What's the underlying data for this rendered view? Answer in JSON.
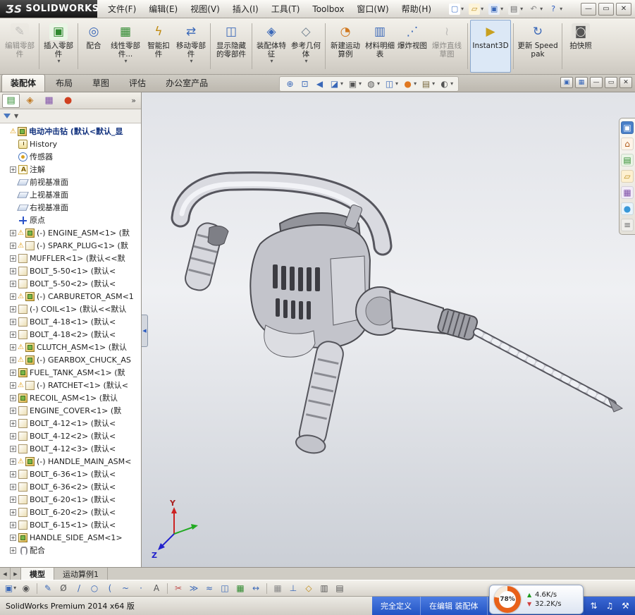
{
  "titlebar": {
    "logo_mark": "ƷS",
    "logo_text": "SOLIDWORKS",
    "menus": [
      "文件(F)",
      "编辑(E)",
      "视图(V)",
      "插入(I)",
      "工具(T)",
      "Toolbox",
      "窗口(W)",
      "帮助(H)"
    ],
    "qat": [
      {
        "name": "new-document",
        "ch": "▢",
        "fg": "#4a78c8",
        "bg": "#ffffff",
        "dd": true
      },
      {
        "name": "open-document",
        "ch": "▱",
        "fg": "#c09020",
        "bg": "#fdf4da",
        "dd": true
      },
      {
        "name": "save-document",
        "ch": "▣",
        "fg": "#3a68b8",
        "bg": "#e8eef8",
        "dd": true
      },
      {
        "name": "print-document",
        "ch": "▤",
        "fg": "#666666",
        "bg": "#eeede9",
        "dd": true
      },
      {
        "name": "undo",
        "ch": "↶",
        "fg": "#888888",
        "dd": true
      },
      {
        "name": "help",
        "ch": "?",
        "fg": "#2a5ac0",
        "dd": true
      }
    ],
    "window_controls": [
      {
        "name": "window-minimize",
        "ch": "—"
      },
      {
        "name": "window-maximize",
        "ch": "▭"
      },
      {
        "name": "window-close",
        "ch": "✕"
      }
    ]
  },
  "ribbon": {
    "buttons": [
      {
        "name": "edit-component",
        "label": "编辑零部件",
        "disabled": true,
        "icon": {
          "ch": "✎",
          "fg": "#8a8a8a",
          "bg": "#e9e6df"
        },
        "sep": true,
        "w": 48
      },
      {
        "name": "insert-component",
        "label": "插入零部件",
        "dd": true,
        "icon": {
          "ch": "▣",
          "fg": "#2f8a2f",
          "bg": "#eaf5e6"
        },
        "sep": true,
        "w": 48
      },
      {
        "name": "mate",
        "label": "配合",
        "icon": {
          "ch": "◎",
          "fg": "#3a68b8"
        },
        "w": 38
      },
      {
        "name": "linear-component-pattern",
        "label": "线性零部件...",
        "dd": true,
        "icon": {
          "ch": "▦",
          "fg": "#2f8a2f"
        },
        "w": 50
      },
      {
        "name": "smart-fasteners",
        "label": "智能扣件",
        "icon": {
          "ch": "ϟ",
          "fg": "#c08a10"
        },
        "w": 42
      },
      {
        "name": "move-component",
        "label": "移动零部件",
        "dd": true,
        "icon": {
          "ch": "⇄",
          "fg": "#3a68b8"
        },
        "sep": true,
        "w": 48
      },
      {
        "name": "show-hidden-components",
        "label": "显示隐藏的零部件",
        "icon": {
          "ch": "◫",
          "fg": "#3a68b8"
        },
        "sep": true,
        "w": 52
      },
      {
        "name": "assembly-features",
        "label": "装配体特征",
        "dd": true,
        "icon": {
          "ch": "◈",
          "fg": "#3a68b8"
        },
        "w": 48
      },
      {
        "name": "reference-geometry",
        "label": "参考几何体",
        "dd": true,
        "icon": {
          "ch": "◇",
          "fg": "#708090"
        },
        "sep": true,
        "w": 48
      },
      {
        "name": "new-motion-study",
        "label": "新建运动算例",
        "icon": {
          "ch": "◔",
          "fg": "#d07820"
        },
        "w": 50
      },
      {
        "name": "bill-of-materials",
        "label": "材料明细表",
        "icon": {
          "ch": "▥",
          "fg": "#3a68b8"
        },
        "w": 46
      },
      {
        "name": "exploded-view",
        "label": "爆炸视图",
        "icon": {
          "ch": "⋰",
          "fg": "#3a68b8"
        },
        "w": 44
      },
      {
        "name": "explode-line-sketch",
        "label": "爆炸直线草图",
        "disabled": true,
        "icon": {
          "ch": "≀",
          "fg": "#8a8a8a"
        },
        "sep": true,
        "w": 52
      },
      {
        "name": "instant3d",
        "label": "Instant3D",
        "pressed": true,
        "icon": {
          "ch": "▶",
          "fg": "#c8a020"
        },
        "sep": true,
        "w": 58
      },
      {
        "name": "update-speedpak",
        "label": "更新 Speedpak",
        "icon": {
          "ch": "↻",
          "fg": "#3a68b8"
        },
        "sep": true,
        "w": 62
      },
      {
        "name": "take-snapshot",
        "label": "拍快照",
        "icon": {
          "ch": "◙",
          "fg": "#555555",
          "bg": "#e4e2dc"
        },
        "w": 46
      }
    ]
  },
  "tabs": [
    {
      "label": "装配体",
      "active": true
    },
    {
      "label": "布局"
    },
    {
      "label": "草图"
    },
    {
      "label": "评估"
    },
    {
      "label": "办公室产品"
    }
  ],
  "headsup": [
    {
      "name": "zoom-to-fit",
      "ch": "⊕",
      "fg": "#3a68b8"
    },
    {
      "name": "zoom-to-area",
      "ch": "⊡",
      "fg": "#3a68b8"
    },
    {
      "name": "previous-view",
      "ch": "◀",
      "fg": "#3a68b8"
    },
    {
      "name": "section-view",
      "ch": "◪",
      "fg": "#3a68b8",
      "dd": true
    },
    {
      "name": "view-orientation",
      "ch": "▣",
      "fg": "#555555",
      "dd": true
    },
    {
      "name": "display-style",
      "ch": "◍",
      "fg": "#555555",
      "dd": true
    },
    {
      "name": "hide-show-items",
      "ch": "◫",
      "fg": "#3a68b8",
      "dd": true
    },
    {
      "name": "edit-appearance",
      "ch": "●",
      "fg": "#e07820",
      "dd": true
    },
    {
      "name": "apply-scene",
      "ch": "▤",
      "fg": "#7a6a40",
      "dd": true
    },
    {
      "name": "view-settings",
      "ch": "◐",
      "fg": "#555555",
      "dd": true
    }
  ],
  "doc_controls": [
    {
      "name": "new-window",
      "ch": "▣",
      "fg": "#3a68b8"
    },
    {
      "name": "tile-windows",
      "ch": "▦",
      "fg": "#3a68b8"
    },
    {
      "name": "document-minimize",
      "ch": "—"
    },
    {
      "name": "document-restore",
      "ch": "▭"
    },
    {
      "name": "document-close",
      "ch": "✕"
    }
  ],
  "left_panel": {
    "tabs": [
      {
        "name": "featuremanager",
        "ch": "▤",
        "fg": "#2f8a2f",
        "active": true
      },
      {
        "name": "propertymanager",
        "ch": "◈",
        "fg": "#c07820"
      },
      {
        "name": "configurationmanager",
        "ch": "▦",
        "fg": "#8050a8"
      },
      {
        "name": "displaymanager",
        "ch": "●",
        "fg": "#d04020"
      }
    ],
    "more": "»",
    "filter_arrow": "▼"
  },
  "tree": {
    "items": [
      {
        "label": "电动冲击钻 (默认<默认_显",
        "icon": "root",
        "warn": true
      },
      {
        "label": "History",
        "icon": "history"
      },
      {
        "label": "传感器",
        "icon": "sensors"
      },
      {
        "label": "注解",
        "icon": "annotations",
        "exp": true
      },
      {
        "label": "前视基准面",
        "icon": "plane"
      },
      {
        "label": "上视基准面",
        "icon": "plane"
      },
      {
        "label": "右视基准面",
        "icon": "plane"
      },
      {
        "label": "原点",
        "icon": "origin"
      },
      {
        "label": "(-) ENGINE_ASM<1> (默",
        "icon": "assembly",
        "warn": true,
        "exp": true
      },
      {
        "label": "(-) SPARK_PLUG<1> (默",
        "icon": "part",
        "warn": true,
        "exp": true
      },
      {
        "label": "MUFFLER<1> (默认<<默",
        "icon": "part",
        "exp": true
      },
      {
        "label": "BOLT_5-50<1> (默认<",
        "icon": "part",
        "exp": true
      },
      {
        "label": "BOLT_5-50<2> (默认<",
        "icon": "part",
        "exp": true
      },
      {
        "label": "(-) CARBURETOR_ASM<1",
        "icon": "assembly",
        "warn": true,
        "exp": true
      },
      {
        "label": "(-) COIL<1> (默认<<默认",
        "icon": "part",
        "exp": true
      },
      {
        "label": "BOLT_4-18<1> (默认<",
        "icon": "part",
        "exp": true
      },
      {
        "label": "BOLT_4-18<2> (默认<",
        "icon": "part",
        "exp": true
      },
      {
        "label": "CLUTCH_ASM<1> (默认",
        "icon": "assembly",
        "warn": true,
        "exp": true
      },
      {
        "label": "(-) GEARBOX_CHUCK_AS",
        "icon": "assembly",
        "warn": true,
        "exp": true
      },
      {
        "label": "FUEL_TANK_ASM<1> (默",
        "icon": "assembly",
        "exp": true
      },
      {
        "label": "(-) RATCHET<1> (默认<",
        "icon": "part",
        "warn": true,
        "exp": true
      },
      {
        "label": "RECOIL_ASM<1> (默认",
        "icon": "assembly",
        "exp": true
      },
      {
        "label": "ENGINE_COVER<1> (默",
        "icon": "part",
        "exp": true
      },
      {
        "label": "BOLT_4-12<1> (默认<",
        "icon": "part",
        "exp": true
      },
      {
        "label": "BOLT_4-12<2> (默认<",
        "icon": "part",
        "exp": true
      },
      {
        "label": "BOLT_4-12<3> (默认<",
        "icon": "part",
        "exp": true
      },
      {
        "label": "(-) HANDLE_MAIN_ASM<",
        "icon": "assembly",
        "warn": true,
        "exp": true
      },
      {
        "label": "BOLT_6-36<1> (默认<",
        "icon": "part",
        "exp": true
      },
      {
        "label": "BOLT_6-36<2> (默认<",
        "icon": "part",
        "exp": true
      },
      {
        "label": "BOLT_6-20<1> (默认<",
        "icon": "part",
        "exp": true
      },
      {
        "label": "BOLT_6-20<2> (默认<",
        "icon": "part",
        "exp": true
      },
      {
        "label": "BOLT_6-15<1> (默认<",
        "icon": "part",
        "exp": true
      },
      {
        "label": "HANDLE_SIDE_ASM<1>",
        "icon": "assembly",
        "exp": true
      },
      {
        "label": "配合",
        "icon": "mates",
        "exp": true
      }
    ]
  },
  "task_pane": [
    {
      "name": "solidworks-resources",
      "ch": "▣",
      "fg": "#ffffff",
      "bg": "#4a80c8"
    },
    {
      "name": "home",
      "ch": "⌂",
      "fg": "#b05818",
      "bg": "#fdf4e8"
    },
    {
      "name": "design-library",
      "ch": "▤",
      "fg": "#2f8a2f",
      "bg": "#eaf5e6"
    },
    {
      "name": "file-explorer",
      "ch": "▱",
      "fg": "#c09020",
      "bg": "#fdf0d0"
    },
    {
      "name": "view-palette",
      "ch": "▦",
      "fg": "#8050a8",
      "bg": "#f2ecf8"
    },
    {
      "name": "appearances",
      "ch": "●",
      "fg": "#3898d8",
      "bg": "#e8f4fc"
    },
    {
      "name": "custom-properties",
      "ch": "≡",
      "fg": "#666666",
      "bg": "#efeeea"
    }
  ],
  "viewport": {
    "triad": {
      "y": "Y",
      "z": "Z"
    }
  },
  "bottom_tabs": [
    {
      "label": "模型",
      "active": true
    },
    {
      "label": "运动算例1"
    }
  ],
  "sketchbar": [
    {
      "name": "save-toolbar",
      "ch": "▣",
      "fg": "#3a68b8",
      "dd": true
    },
    {
      "name": "select",
      "ch": "◉",
      "fg": "#555555"
    },
    {
      "sep": true
    },
    {
      "name": "sketch",
      "ch": "✎",
      "fg": "#3a68b8"
    },
    {
      "name": "smart-dimension",
      "ch": "Ø",
      "fg": "#555555"
    },
    {
      "name": "line",
      "ch": "/",
      "fg": "#3a68b8"
    },
    {
      "name": "circle",
      "ch": "○",
      "fg": "#3a68b8"
    },
    {
      "name": "arc",
      "ch": "(",
      "fg": "#3a68b8"
    },
    {
      "name": "spline",
      "ch": "~",
      "fg": "#3a68b8"
    },
    {
      "name": "point",
      "ch": "·",
      "fg": "#3a68b8"
    },
    {
      "name": "text-sketch",
      "ch": "A",
      "fg": "#555555"
    },
    {
      "sep": true
    },
    {
      "name": "trim-entities",
      "ch": "✂",
      "fg": "#c05050"
    },
    {
      "name": "convert-entities",
      "ch": "≫",
      "fg": "#3a68b8"
    },
    {
      "name": "offset-entities",
      "ch": "≈",
      "fg": "#3a68b8"
    },
    {
      "name": "mirror-entities",
      "ch": "◫",
      "fg": "#3a68b8"
    },
    {
      "name": "linear-sketch-pattern",
      "ch": "▦",
      "fg": "#2f8a2f"
    },
    {
      "name": "move-entities",
      "ch": "↔",
      "fg": "#3a68b8"
    },
    {
      "sep": true
    },
    {
      "name": "display-grid",
      "ch": "▦",
      "fg": "#8a8a8a"
    },
    {
      "name": "add-relation",
      "ch": "⊥",
      "fg": "#3a68b8"
    },
    {
      "name": "quick-snaps",
      "ch": "◇",
      "fg": "#c08a10"
    },
    {
      "name": "split-view",
      "ch": "▥",
      "fg": "#555555"
    },
    {
      "name": "pane-layout",
      "ch": "▤",
      "fg": "#555555"
    }
  ],
  "statusbar": {
    "product": "SolidWorks Premium 2014 x64 版",
    "define_state": "完全定义",
    "editing_state": "在编辑 装配体",
    "cpu": "78%",
    "up_speed": "4.6K/s",
    "down_speed": "32.2K/s",
    "tray": [
      {
        "name": "network-tray-icon",
        "ch": "⇅",
        "fg": "#ffffff"
      },
      {
        "name": "volume-tray-icon",
        "ch": "♫",
        "fg": "#ffffff"
      },
      {
        "name": "tools-tray-icon",
        "ch": "⚒",
        "fg": "#ffffff"
      }
    ]
  },
  "colors": {
    "accent_blue": "#2254c4",
    "warning_yellow": "#e09800",
    "gauge_orange": "#e8611a"
  }
}
